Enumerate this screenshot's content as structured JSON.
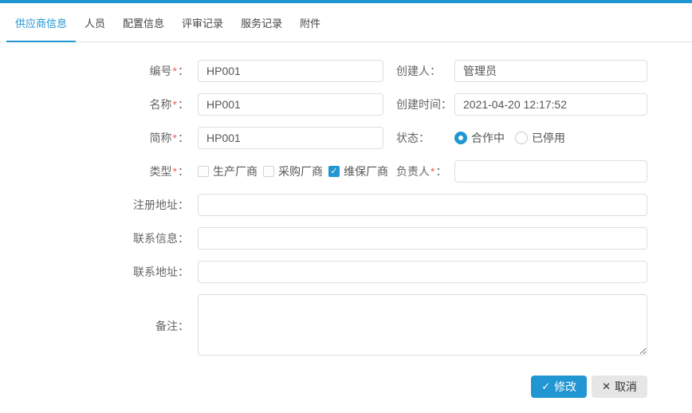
{
  "colors": {
    "accent": "#2196d3",
    "required": "#f25c5c",
    "input_border": "#dcdee2"
  },
  "required_mark": "*",
  "colon": "：",
  "icons": {
    "check": "✓",
    "close": "✕"
  },
  "tabs": [
    {
      "label": "供应商信息",
      "active": true
    },
    {
      "label": "人员",
      "active": false
    },
    {
      "label": "配置信息",
      "active": false
    },
    {
      "label": "评审记录",
      "active": false
    },
    {
      "label": "服务记录",
      "active": false
    },
    {
      "label": "附件",
      "active": false
    }
  ],
  "form": {
    "code": {
      "label": "编号",
      "required": true,
      "value": "HP001"
    },
    "creator": {
      "label": "创建人",
      "required": false,
      "value": "管理员"
    },
    "name": {
      "label": "名称",
      "required": true,
      "value": "HP001"
    },
    "created_time": {
      "label": "创建时间",
      "required": false,
      "value": "2021-04-20 12:17:52"
    },
    "short_name": {
      "label": "简称",
      "required": true,
      "value": "HP001"
    },
    "status": {
      "label": "状态",
      "selected": "合作中",
      "options": [
        {
          "label": "合作中",
          "selected": true
        },
        {
          "label": "已停用",
          "selected": false
        }
      ]
    },
    "type": {
      "label": "类型",
      "required": true,
      "options": [
        {
          "label": "生产厂商",
          "checked": false
        },
        {
          "label": "采购厂商",
          "checked": false
        },
        {
          "label": "维保厂商",
          "checked": true
        }
      ]
    },
    "manager": {
      "label": "负责人",
      "required": true,
      "value": ""
    },
    "reg_address": {
      "label": "注册地址",
      "required": false,
      "value": ""
    },
    "contact_info": {
      "label": "联系信息",
      "required": false,
      "value": ""
    },
    "contact_address": {
      "label": "联系地址",
      "required": false,
      "value": ""
    },
    "remark": {
      "label": "备注",
      "required": false,
      "value": ""
    }
  },
  "actions": {
    "modify": "修改",
    "cancel": "取消"
  }
}
